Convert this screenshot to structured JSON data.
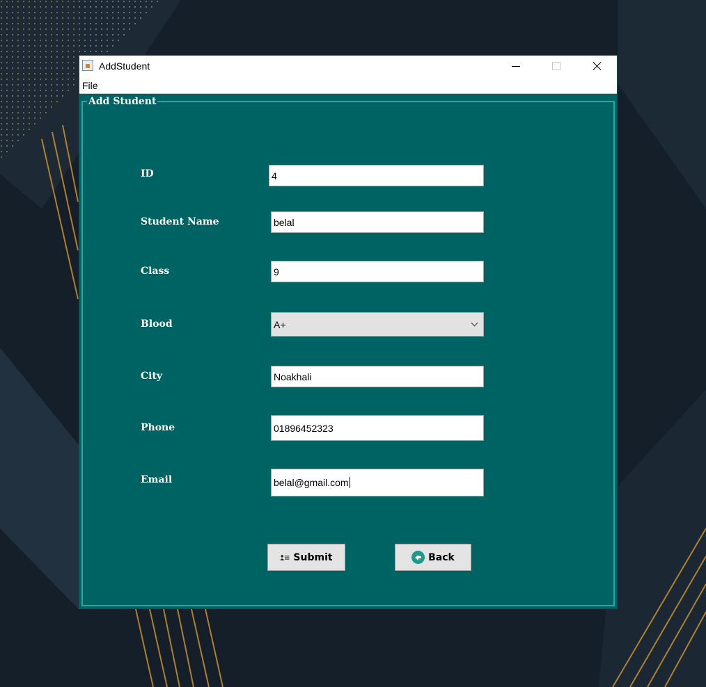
{
  "window": {
    "title": "AddStudent",
    "menu": {
      "file": "File"
    }
  },
  "panel": {
    "title": "Add Student"
  },
  "form": {
    "id": {
      "label": "ID",
      "value": "4"
    },
    "name": {
      "label": "Student Name",
      "value": "belal"
    },
    "class": {
      "label": "Class",
      "value": "9"
    },
    "blood": {
      "label": "Blood",
      "value": "A+"
    },
    "city": {
      "label": "City",
      "value": "Noakhali"
    },
    "phone": {
      "label": "Phone",
      "value": "01896452323"
    },
    "email": {
      "label": "Email",
      "value": "belal@gmail.com"
    }
  },
  "buttons": {
    "submit": "Submit",
    "back": "Back"
  },
  "colors": {
    "panel_bg": "#006363",
    "panel_border": "#27a9a1",
    "back_icon": "#1a9c8d"
  },
  "icons": {
    "app": "java-app-icon",
    "submit": "user-list-icon",
    "back": "back-arrow-icon"
  }
}
